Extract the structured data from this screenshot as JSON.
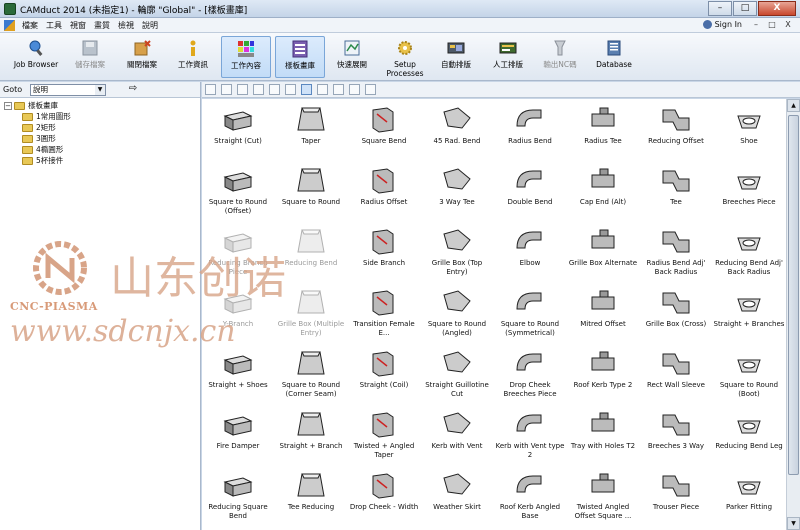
{
  "window": {
    "title": "CAMduct 2014 (未指定1) - 輪廓 \"Global\" - [樣板畫庫]",
    "minimize": "–",
    "maximize": "□",
    "close": "X"
  },
  "menu": {
    "items": [
      "檔案",
      "工具",
      "視窗",
      "畫質",
      "檢視",
      "說明"
    ],
    "signin": "Sign In",
    "mdi": [
      "–",
      "□",
      "X"
    ]
  },
  "toolbar": {
    "buttons": [
      {
        "label": "Job Browser",
        "icon": "job-browser-icon",
        "state": "normal"
      },
      {
        "label": "儲存檔案",
        "icon": "save-icon",
        "state": "disabled"
      },
      {
        "label": "關閉檔案",
        "icon": "close-file-icon",
        "state": "normal"
      },
      {
        "label": "工作資訊",
        "icon": "info-icon",
        "state": "normal"
      },
      {
        "label": "工作內容",
        "icon": "job-content-icon",
        "state": "active"
      },
      {
        "label": "樣板畫庫",
        "icon": "pattern-library-icon",
        "state": "active"
      },
      {
        "label": "快速展開",
        "icon": "quick-develop-icon",
        "state": "normal"
      },
      {
        "label": "Setup",
        "label2": "Processes",
        "icon": "setup-processes-icon",
        "state": "normal"
      },
      {
        "label": "自動排版",
        "icon": "auto-nest-icon",
        "state": "normal"
      },
      {
        "label": "人工排版",
        "icon": "manual-nest-icon",
        "state": "normal"
      },
      {
        "label": "輸出NC碼",
        "icon": "nc-output-icon",
        "state": "disabled"
      },
      {
        "label": "Database",
        "icon": "database-icon",
        "state": "normal"
      }
    ]
  },
  "goto": {
    "label": "Goto",
    "selected": "說明",
    "go": "⇨"
  },
  "tree": {
    "root": "樣板畫庫",
    "children": [
      "1常用圖形",
      "2矩形",
      "3圓形",
      "4橢圓形",
      "5杯接件"
    ]
  },
  "grid": {
    "items": [
      {
        "label": "Straight (Cut)"
      },
      {
        "label": "Taper"
      },
      {
        "label": "Square Bend"
      },
      {
        "label": "45 Rad. Bend"
      },
      {
        "label": "Radius Bend"
      },
      {
        "label": "Radius Tee"
      },
      {
        "label": "Reducing Offset"
      },
      {
        "label": "Shoe"
      },
      {
        "label": "Square to Round (Offset)"
      },
      {
        "label": "Square to Round"
      },
      {
        "label": "Radius Offset"
      },
      {
        "label": "3 Way Tee"
      },
      {
        "label": "Double Bend"
      },
      {
        "label": "Cap End (Alt)"
      },
      {
        "label": "Tee"
      },
      {
        "label": "Breeches Piece"
      },
      {
        "label": "Reducing Branch Piece",
        "faded": true
      },
      {
        "label": "Reducing Bend",
        "faded": true
      },
      {
        "label": "Side Branch"
      },
      {
        "label": "Grille Box (Top Entry)"
      },
      {
        "label": "Elbow"
      },
      {
        "label": "Grille Box Alternate"
      },
      {
        "label": "Radius Bend Adj' Back Radius"
      },
      {
        "label": "Reducing Bend Adj' Back Radius"
      },
      {
        "label": "Y-Branch",
        "faded": true
      },
      {
        "label": "Grille Box (Multiple Entry)",
        "faded": true
      },
      {
        "label": "Transition Female E..."
      },
      {
        "label": "Square to Round (Angled)"
      },
      {
        "label": "Square to Round (Symmetrical)"
      },
      {
        "label": "Mitred Offset"
      },
      {
        "label": "Grille Box (Cross)"
      },
      {
        "label": "Straight + Branches"
      },
      {
        "label": "Straight + Shoes"
      },
      {
        "label": "Square to Round (Corner Seam)"
      },
      {
        "label": "Straight (Coil)"
      },
      {
        "label": "Straight Guillotine Cut"
      },
      {
        "label": "Drop Cheek Breeches Piece"
      },
      {
        "label": "Roof Kerb Type 2"
      },
      {
        "label": "Rect Wall Sleeve"
      },
      {
        "label": "Square to Round (Boot)"
      },
      {
        "label": "Fire Damper"
      },
      {
        "label": "Straight + Branch"
      },
      {
        "label": "Twisted + Angled Taper"
      },
      {
        "label": "Kerb with Vent"
      },
      {
        "label": "Kerb with Vent type 2"
      },
      {
        "label": "Tray with Holes T2"
      },
      {
        "label": "Breeches 3 Way"
      },
      {
        "label": "Reducing Bend Leg"
      },
      {
        "label": "Reducing Square Bend"
      },
      {
        "label": "Tee Reducing"
      },
      {
        "label": "Drop Cheek - Width"
      },
      {
        "label": "Weather Skirt"
      },
      {
        "label": "Roof Kerb Angled Base"
      },
      {
        "label": "Twisted Angled Offset Square ..."
      },
      {
        "label": "Trouser Piece"
      },
      {
        "label": "Parker Fitting"
      }
    ]
  },
  "watermark": {
    "brand": "CNC-PIASMA",
    "cn_text": "山东创诺",
    "url": "www.sdcnjx.cn"
  }
}
